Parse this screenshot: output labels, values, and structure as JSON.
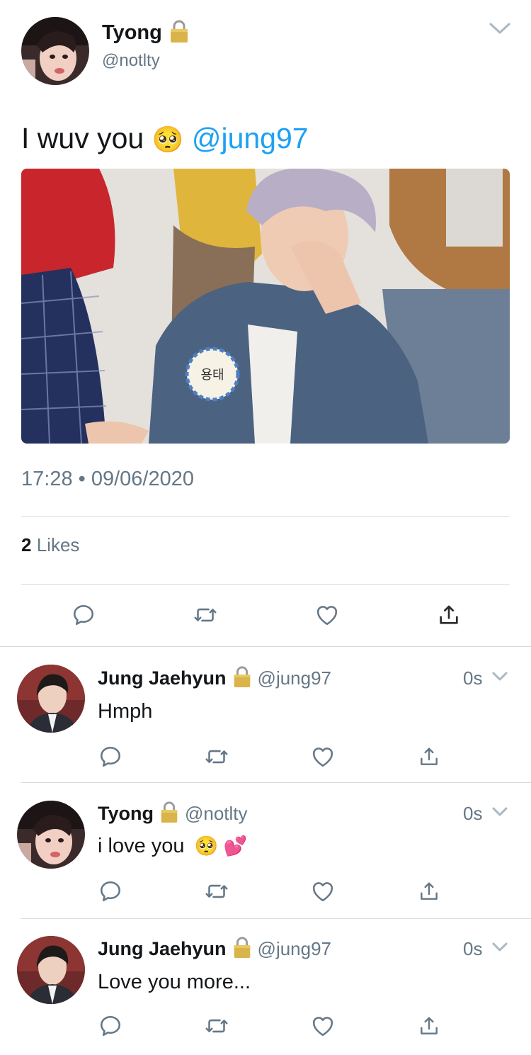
{
  "main_tweet": {
    "name": "Tyong",
    "handle": "@notlty",
    "text": "I wuv you",
    "emoji": "🥺",
    "mention": "@jung97",
    "timestamp": "17:28 • 09/06/2020",
    "likes_count": "2",
    "likes_label": "Likes"
  },
  "replies": [
    {
      "name": "Jung Jaehyun",
      "handle": "@jung97",
      "time": "0s",
      "text": "Hmph",
      "emoji": ""
    },
    {
      "name": "Tyong",
      "handle": "@notlty",
      "time": "0s",
      "text": "i love you",
      "emoji": "🥺 💕"
    },
    {
      "name": "Jung Jaehyun",
      "handle": "@jung97",
      "time": "0s",
      "text": "Love you more...",
      "emoji": ""
    }
  ],
  "icons": {
    "reply": "reply-icon",
    "retweet": "retweet-icon",
    "like": "heart-icon",
    "share": "share-icon",
    "lock": "lock-icon",
    "more": "chevron-down-icon"
  },
  "colors": {
    "link": "#1da1f2",
    "secondary_text": "#657786",
    "icon": "#657786",
    "divider": "#d6dbdf"
  }
}
